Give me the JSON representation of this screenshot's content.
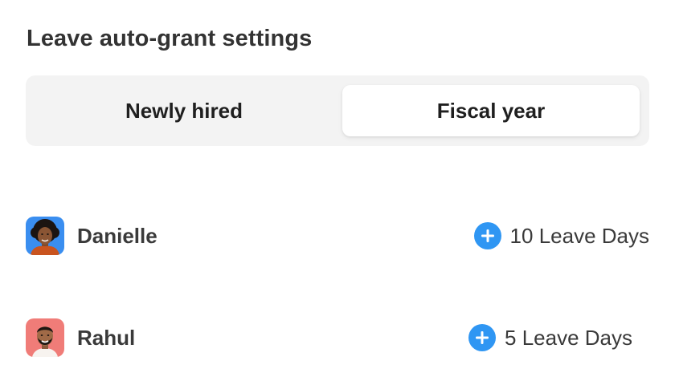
{
  "title": "Leave auto-grant settings",
  "tabs": [
    {
      "label": "Newly hired",
      "active": false
    },
    {
      "label": "Fiscal year",
      "active": true
    }
  ],
  "employees": [
    {
      "name": "Danielle",
      "leave_days": "10 Leave Days",
      "avatar_bg": "#3a8ef0",
      "add_icon": "plus-circle-icon"
    },
    {
      "name": "Rahul",
      "leave_days": "5 Leave Days",
      "avatar_bg": "#f07c78",
      "add_icon": "plus-circle-icon"
    }
  ],
  "colors": {
    "accent": "#2f96f3",
    "segment_bg": "#f3f3f3",
    "text": "#333333"
  }
}
